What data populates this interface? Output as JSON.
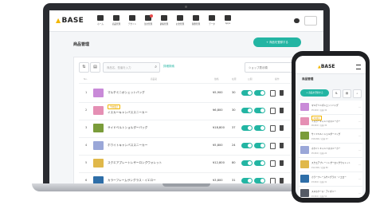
{
  "app": {
    "brand": "BASE",
    "nav": [
      {
        "label": "ホーム",
        "icon": "home-icon"
      },
      {
        "label": "商品管理",
        "icon": "shirt-icon"
      },
      {
        "label": "デザイン",
        "icon": "brush-icon"
      },
      {
        "label": "注文管理",
        "icon": "cart-icon"
      },
      {
        "label": "顧客管理",
        "icon": "card-icon"
      },
      {
        "label": "お金管理",
        "icon": "money-icon"
      },
      {
        "label": "税務管理",
        "icon": "document-icon"
      },
      {
        "label": "データ",
        "icon": "chart-icon"
      },
      {
        "label": "Apps",
        "icon": "apps-icon"
      }
    ]
  },
  "page": {
    "title": "商品管理",
    "add_button": "+ 商品を登録する",
    "search_placeholder": "商品名、型番を入力",
    "detail_link": "詳細検索",
    "select_value": "ショップ表示順",
    "headers": {
      "no": "No.",
      "name": "商品名",
      "price": "価格",
      "stock": "在庫",
      "public": "公開",
      "action": "操作"
    },
    "accent_color": "#23b5a3",
    "items": [
      {
        "no": "1",
        "name": "マルチミニポシェットバッグ",
        "price": "¥5,900",
        "stock": "30",
        "badge": "",
        "thumb_color": "#c98ad8"
      },
      {
        "no": "2",
        "name": "イスカーキャンバススニーカー",
        "price": "¥6,800",
        "stock": "30",
        "badge": "予約販売",
        "thumb_color": "#e58fb4"
      },
      {
        "no": "3",
        "name": "サイドベルトショルダーバッグ",
        "price": "¥18,800",
        "stock": "37",
        "badge": "",
        "thumb_color": "#7a9c3a"
      },
      {
        "no": "4",
        "name": "ホワイトキャンバススニーカー",
        "price": "¥5,800",
        "stock": "24",
        "badge": "",
        "thumb_color": "#9aa7d8"
      },
      {
        "no": "5",
        "name": "スクエアプレートレザーロングウォレット",
        "price": "¥12,800",
        "stock": "80",
        "badge": "",
        "thumb_color": "#e0b84a"
      },
      {
        "no": "6",
        "name": "カラーフレームサングラス・イエロー",
        "price": "¥3,800",
        "stock": "31",
        "badge": "",
        "thumb_color": "#2e6ea8"
      }
    ]
  },
  "phone": {
    "brand": "BASE",
    "title": "商品管理",
    "add_button": "+ 商品を登録する",
    "items": [
      {
        "name": "マルチミニポシェットバッグ",
        "price": "¥5,900 / 在庫 30",
        "badge": "",
        "thumb_color": "#c98ad8"
      },
      {
        "name": "イスカーキャンバススニーカー",
        "price": "¥6,800 / 在庫 30",
        "badge": "予約販売",
        "thumb_color": "#e58fb4"
      },
      {
        "name": "サイドベルトショルダーバッグ",
        "price": "¥18,800 / 在庫 37",
        "badge": "",
        "thumb_color": "#7a9c3a"
      },
      {
        "name": "ホワイトキャンバススニーカー",
        "price": "¥5,800 / 在庫 24",
        "badge": "",
        "thumb_color": "#9aa7d8"
      },
      {
        "name": "スクエアプレートレザーロングウォレット",
        "price": "¥12,800 / 在庫 80",
        "badge": "",
        "thumb_color": "#e0b84a"
      },
      {
        "name": "カラーフレームサングラス・イエロー",
        "price": "¥3,800 / 在庫 31",
        "badge": "",
        "thumb_color": "#2e6ea8"
      },
      {
        "name": "スマホケース・アイボリー",
        "price": "¥2,800 / 在庫 50",
        "badge": "",
        "thumb_color": "#555b66"
      }
    ]
  }
}
